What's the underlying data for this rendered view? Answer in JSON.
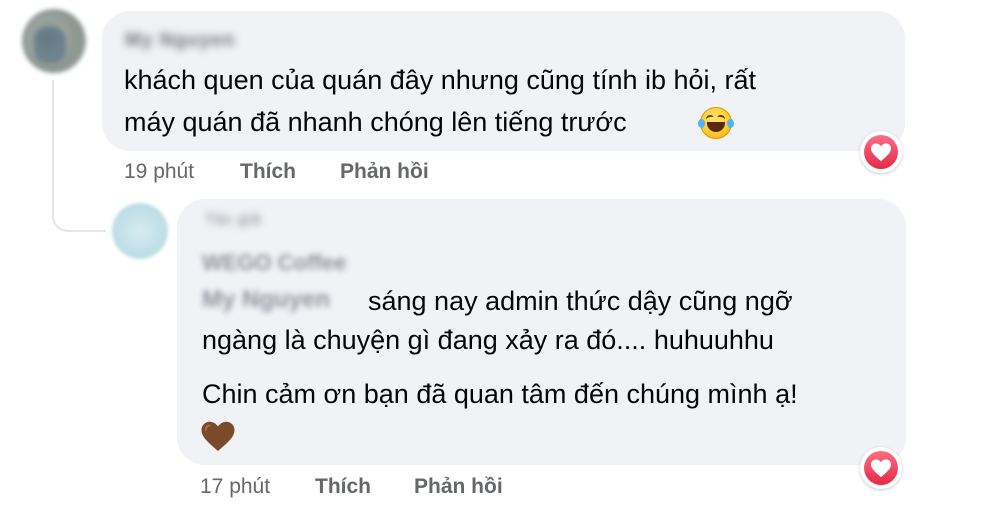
{
  "comment1": {
    "author": "My Nguyen",
    "lines": [
      "khách quen của quán đây nhưng cũng tính ib hỏi, rất",
      "máy quán đã nhanh chóng lên tiếng trước"
    ],
    "emoji": "laughing-tears",
    "time": "19 phút",
    "like_label": "Thích",
    "reply_label": "Phản hồi",
    "reaction": "heart"
  },
  "reply1": {
    "author_badge": "Tác giả",
    "author": "WEGO Coffee",
    "mention": "My Nguyen",
    "line1_rest": "sáng nay admin thức dậy cũng ngỡ",
    "line2": "ngàng là chuyện gì đang xảy ra đó.... huhuuhhu",
    "line3": "Chin cảm ơn bạn đã quan tâm đến chúng mình ạ!",
    "emoji": "brown-heart",
    "time": "17 phút",
    "like_label": "Thích",
    "reply_label": "Phản hồi",
    "reaction": "heart"
  },
  "colors": {
    "bubble": "#f0f2f5",
    "meta_text": "#65676b",
    "reaction_red": "#e42a48",
    "heart_brown": "#7b4a2a"
  }
}
